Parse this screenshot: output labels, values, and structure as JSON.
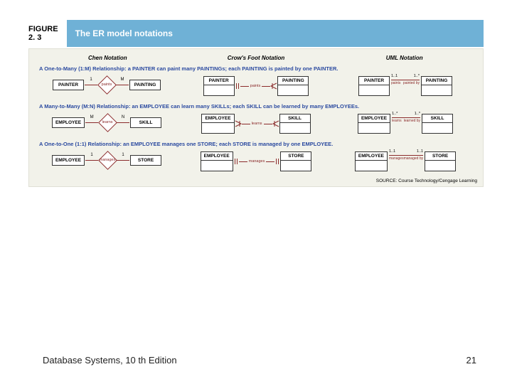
{
  "figure": {
    "label": "FIGURE",
    "number": "2. 3",
    "title": "The ER model notations"
  },
  "columns": {
    "c1": "Chen Notation",
    "c2": "Crow's Foot Notation",
    "c3": "UML Notation"
  },
  "sections": {
    "s1": {
      "desc": "A One-to-Many (1:M) Relationship: a PAINTER can paint many PAINTINGs; each PAINTING is painted by one PAINTER.",
      "left": "PAINTER",
      "right": "PAINTING",
      "rel": "paints",
      "chen_l": "1",
      "chen_r": "M",
      "uml_l": "1..1",
      "uml_r": "1..*",
      "uml_ll": "paints",
      "uml_rl": "painted by"
    },
    "s2": {
      "desc": "A Many-to-Many (M:N) Relationship: an EMPLOYEE can learn many SKILLs; each SKILL can be learned by many EMPLOYEEs.",
      "left": "EMPLOYEE",
      "right": "SKILL",
      "rel": "learns",
      "chen_l": "M",
      "chen_r": "N",
      "uml_l": "1..*",
      "uml_r": "1..*",
      "uml_ll": "learns",
      "uml_rl": "learned by"
    },
    "s3": {
      "desc": "A One-to-One (1:1) Relationship: an EMPLOYEE manages one STORE; each STORE is managed by one EMPLOYEE.",
      "left": "EMPLOYEE",
      "right": "STORE",
      "rel": "manages",
      "chen_l": "1",
      "chen_r": "1",
      "uml_l": "1..1",
      "uml_r": "1..1",
      "uml_ll": "manages",
      "uml_rl": "managed by"
    }
  },
  "source": "SOURCE: Course Technology/Cengage Learning",
  "footer": {
    "left": "Database Systems, 10 th Edition",
    "right": "21"
  }
}
